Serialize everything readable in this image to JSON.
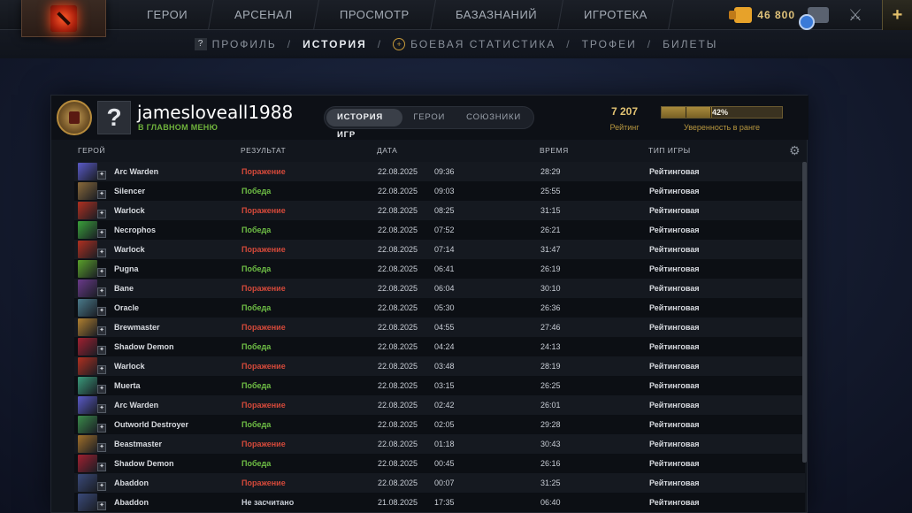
{
  "topbar": {
    "nav": [
      "ГЕРОИ",
      "АРСЕНАЛ",
      "ПРОСМОТР",
      "БАЗАЗНАНИЙ",
      "ИГРОТЕКА"
    ],
    "coins": "46 800",
    "plus_symbol": "+"
  },
  "subnav": {
    "profile": "ПРОФИЛЬ",
    "history": "ИСТОРИЯ",
    "stats": "БОЕВАЯ СТАТИСТИКА",
    "trophies": "ТРОФЕИ",
    "tickets": "БИЛЕТЫ",
    "separator": "/"
  },
  "profile": {
    "avatar_char": "?",
    "name": "jamesloveall1988",
    "status": "В ГЛАВНОМ МЕНЮ",
    "tabs": [
      "ИСТОРИЯ ИГР",
      "ГЕРОИ",
      "СОЮЗНИКИ"
    ],
    "rating_value": "7 207",
    "rating_label": "Рейтинг",
    "confidence_pct": "42%",
    "confidence_fraction": 0.42,
    "confidence_label": "Уверенность в ранге"
  },
  "table": {
    "columns": [
      "ГЕРОЙ",
      "РЕЗУЛЬТАТ",
      "ДАТА",
      "ВРЕМЯ",
      "ТИП ИГРЫ"
    ],
    "rows": [
      {
        "hero": "Arc Warden",
        "result": "Поражение",
        "outcome": "loss",
        "date": "22.08.2025",
        "time": "09:36",
        "duration": "28:29",
        "mode": "Рейтинговая",
        "color": "#5a5ac8"
      },
      {
        "hero": "Silencer",
        "result": "Победа",
        "outcome": "win",
        "date": "22.08.2025",
        "time": "09:03",
        "duration": "25:55",
        "mode": "Рейтинговая",
        "color": "#8a6a3a"
      },
      {
        "hero": "Warlock",
        "result": "Поражение",
        "outcome": "loss",
        "date": "22.08.2025",
        "time": "08:25",
        "duration": "31:15",
        "mode": "Рейтинговая",
        "color": "#b03020"
      },
      {
        "hero": "Necrophos",
        "result": "Победа",
        "outcome": "win",
        "date": "22.08.2025",
        "time": "07:52",
        "duration": "26:21",
        "mode": "Рейтинговая",
        "color": "#3aa03a"
      },
      {
        "hero": "Warlock",
        "result": "Поражение",
        "outcome": "loss",
        "date": "22.08.2025",
        "time": "07:14",
        "duration": "31:47",
        "mode": "Рейтинговая",
        "color": "#b03020"
      },
      {
        "hero": "Pugna",
        "result": "Победа",
        "outcome": "win",
        "date": "22.08.2025",
        "time": "06:41",
        "duration": "26:19",
        "mode": "Рейтинговая",
        "color": "#5aa02a"
      },
      {
        "hero": "Bane",
        "result": "Поражение",
        "outcome": "loss",
        "date": "22.08.2025",
        "time": "06:04",
        "duration": "30:10",
        "mode": "Рейтинговая",
        "color": "#6a3a8a"
      },
      {
        "hero": "Oracle",
        "result": "Победа",
        "outcome": "win",
        "date": "22.08.2025",
        "time": "05:30",
        "duration": "26:36",
        "mode": "Рейтинговая",
        "color": "#4a7a8a"
      },
      {
        "hero": "Brewmaster",
        "result": "Поражение",
        "outcome": "loss",
        "date": "22.08.2025",
        "time": "04:55",
        "duration": "27:46",
        "mode": "Рейтинговая",
        "color": "#b08030"
      },
      {
        "hero": "Shadow Demon",
        "result": "Победа",
        "outcome": "win",
        "date": "22.08.2025",
        "time": "04:24",
        "duration": "24:13",
        "mode": "Рейтинговая",
        "color": "#a02030"
      },
      {
        "hero": "Warlock",
        "result": "Поражение",
        "outcome": "loss",
        "date": "22.08.2025",
        "time": "03:48",
        "duration": "28:19",
        "mode": "Рейтинговая",
        "color": "#b03020"
      },
      {
        "hero": "Muerta",
        "result": "Победа",
        "outcome": "win",
        "date": "22.08.2025",
        "time": "03:15",
        "duration": "26:25",
        "mode": "Рейтинговая",
        "color": "#3a9a7a"
      },
      {
        "hero": "Arc Warden",
        "result": "Поражение",
        "outcome": "loss",
        "date": "22.08.2025",
        "time": "02:42",
        "duration": "26:01",
        "mode": "Рейтинговая",
        "color": "#5a5ac8"
      },
      {
        "hero": "Outworld Destroyer",
        "result": "Победа",
        "outcome": "win",
        "date": "22.08.2025",
        "time": "02:05",
        "duration": "29:28",
        "mode": "Рейтинговая",
        "color": "#3a8a4a"
      },
      {
        "hero": "Beastmaster",
        "result": "Поражение",
        "outcome": "loss",
        "date": "22.08.2025",
        "time": "01:18",
        "duration": "30:43",
        "mode": "Рейтинговая",
        "color": "#a0702a"
      },
      {
        "hero": "Shadow Demon",
        "result": "Победа",
        "outcome": "win",
        "date": "22.08.2025",
        "time": "00:45",
        "duration": "26:16",
        "mode": "Рейтинговая",
        "color": "#a02030"
      },
      {
        "hero": "Abaddon",
        "result": "Поражение",
        "outcome": "loss",
        "date": "22.08.2025",
        "time": "00:07",
        "duration": "31:25",
        "mode": "Рейтинговая",
        "color": "#3a4a7a"
      },
      {
        "hero": "Abaddon",
        "result": "Не засчитано",
        "outcome": "nc",
        "date": "21.08.2025",
        "time": "17:35",
        "duration": "06:40",
        "mode": "Рейтинговая",
        "color": "#3a4a7a"
      }
    ]
  }
}
